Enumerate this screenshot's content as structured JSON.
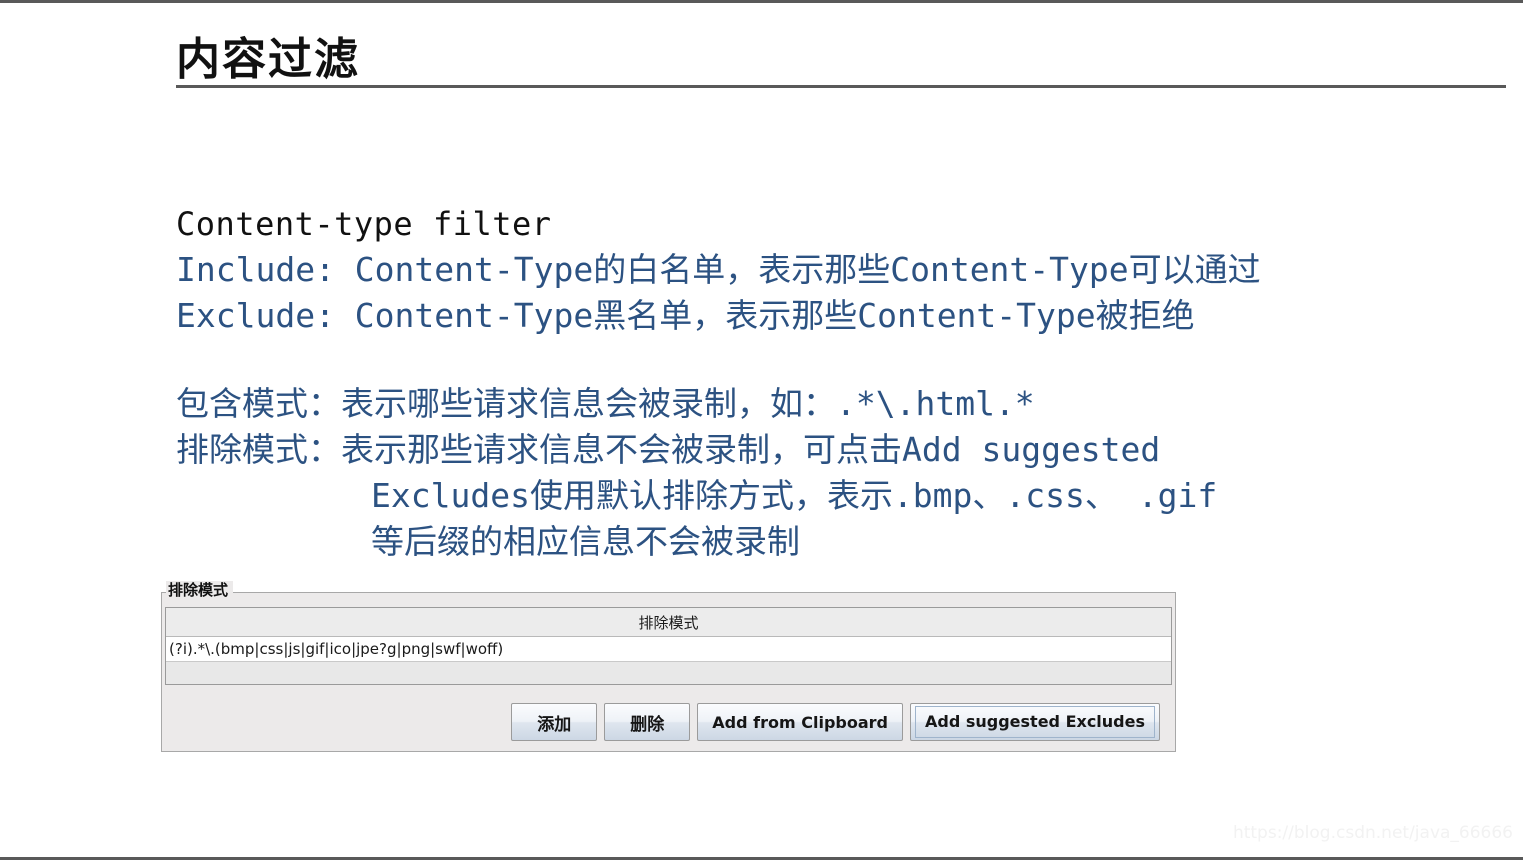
{
  "slide": {
    "title": "内容过滤",
    "watermark": "https://blog.csdn.net/java_66666"
  },
  "body_text": {
    "heading": "Content-type filter",
    "lines": [
      "Include: Content-Type的白名单，表示那些Content-Type可以通过",
      "Exclude: Content-Type黑名单，表示那些Content-Type被拒绝"
    ],
    "lines2": [
      "包含模式：表示哪些请求信息会被录制，如：.*\\.html.*",
      "排除模式：表示那些请求信息不会被录制，可点击Add suggested"
    ],
    "lines2_cont": [
      "Excludes使用默认排除方式，表示.bmp、.css、 .gif",
      "等后缀的相应信息不会被录制"
    ]
  },
  "panel": {
    "legend": "排除模式",
    "table": {
      "header": "排除模式",
      "rows": [
        "(?i).*\\.(bmp|css|js|gif|ico|jpe?g|png|swf|woff)"
      ]
    },
    "buttons": [
      {
        "label": "添加",
        "cjk": true,
        "focused": false
      },
      {
        "label": "删除",
        "cjk": true,
        "focused": false
      },
      {
        "label": "Add from Clipboard",
        "cjk": false,
        "focused": false
      },
      {
        "label": "Add suggested Excludes",
        "cjk": false,
        "focused": true
      }
    ]
  },
  "colors": {
    "body_blue": "#2c5282",
    "rule_gray": "#595959",
    "panel_bg": "#eceaea"
  }
}
